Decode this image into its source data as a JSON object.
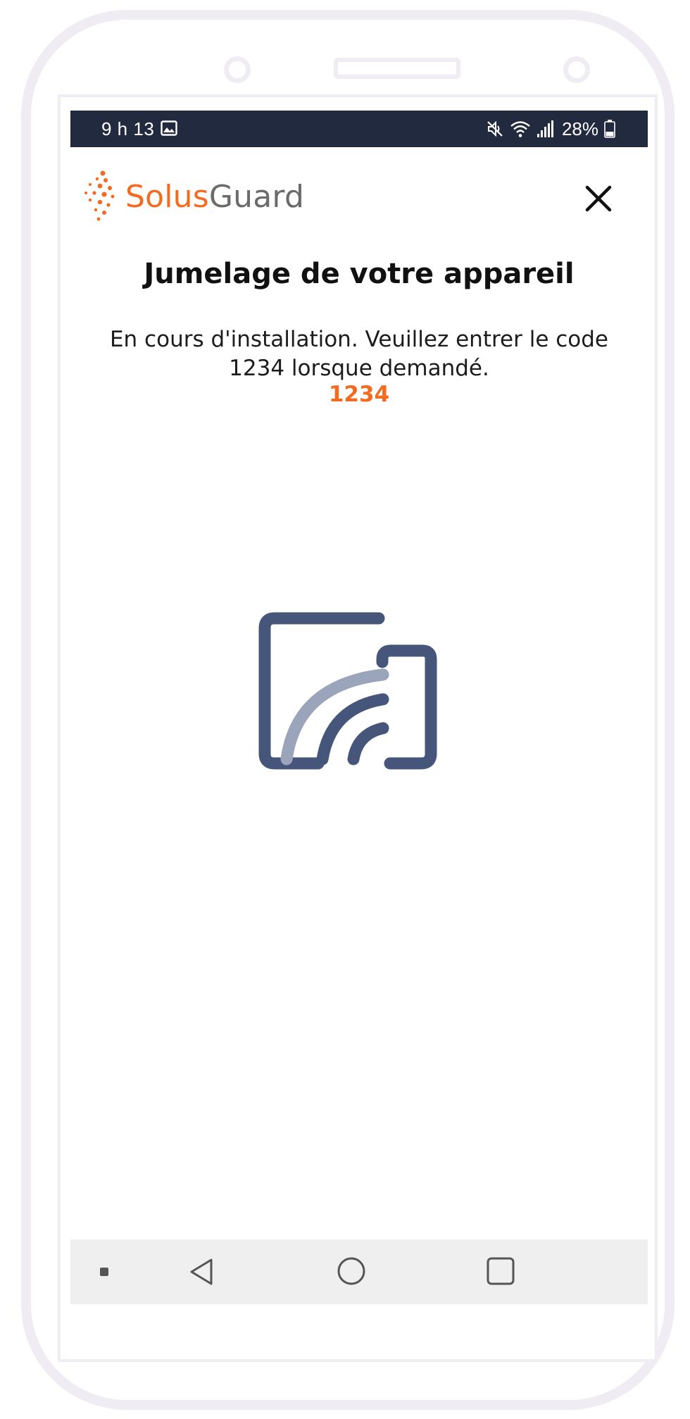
{
  "status_bar": {
    "time": "9 h 13",
    "battery": "28%",
    "icons": [
      "gallery-icon",
      "mute-icon",
      "wifi-icon",
      "signal-icon",
      "battery-icon"
    ]
  },
  "header": {
    "logo": {
      "part1": "Solus",
      "part2": "Guard"
    },
    "close_icon": "close-icon"
  },
  "main": {
    "title": "Jumelage de votre appareil",
    "message": "En cours d'installation. Veuillez entrer le code 1234 lorsque demandé.",
    "code": "1234",
    "illustration": "screen-cast-pairing-icon"
  },
  "nav_bar": {
    "icons": [
      "menu-dot-icon",
      "back-icon",
      "home-icon",
      "recent-apps-icon"
    ]
  },
  "colors": {
    "accent": "#f26b21",
    "status_bar": "#222a3f",
    "icon_dark": "#45567a",
    "icon_light": "#9aa4ba",
    "nav_bar": "#efefef"
  }
}
